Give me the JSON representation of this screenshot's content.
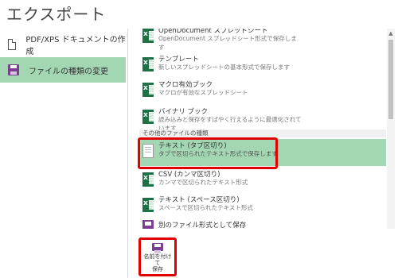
{
  "page": {
    "title": "エクスポート"
  },
  "nav": [
    {
      "label": "PDF/XPS ドキュメントの作成",
      "icon": "pdf-document-icon"
    },
    {
      "label": "ファイルの種類の変更",
      "icon": "save-disk-icon"
    }
  ],
  "file_types": [
    {
      "title": "OpenDocument スプレッドシート",
      "desc": "OpenDocument スプレッドシート形式で保存します",
      "icon": "excel-icon"
    },
    {
      "title": "テンプレート",
      "desc": "新しいスプレッドシートの基本形式で保存します",
      "icon": "excel-icon"
    },
    {
      "title": "マクロ有効ブック",
      "desc": "マクロが有効なスプレッドシート",
      "icon": "excel-icon"
    },
    {
      "title": "バイナリ ブック",
      "desc": "読み込みと保存をすばやく行えるように最適化されています",
      "icon": "excel-icon"
    }
  ],
  "other_section": {
    "label": "その他のファイルの種類"
  },
  "other_types": [
    {
      "title": "テキスト (タブ区切り)",
      "desc": "タブで区切られたテキスト形式で保存します",
      "icon": "text-file-icon"
    },
    {
      "title": "CSV (カンマ区切り)",
      "desc": "カンマで区切られたテキスト形式",
      "icon": "excel-icon"
    },
    {
      "title": "テキスト (スペース区切り)",
      "desc": "スペースで区切られたテキスト形式",
      "icon": "excel-icon"
    },
    {
      "title": "別のファイル形式として保存",
      "desc": "",
      "icon": "save-as-icon"
    }
  ],
  "save_as_button": {
    "label_line1": "名前を付けて",
    "label_line2": "保存",
    "icon": "save-disk-icon"
  },
  "colors": {
    "selected": "#a3d6b2",
    "highlight_border": "#e10000",
    "excel_green": "#1e7145",
    "save_purple": "#7a3f8f"
  }
}
